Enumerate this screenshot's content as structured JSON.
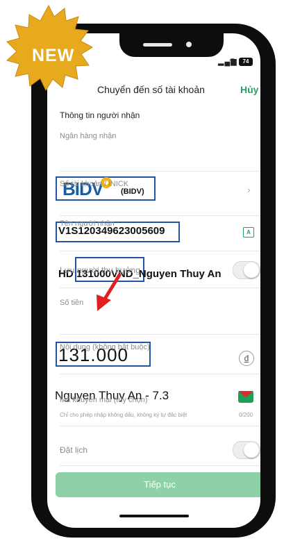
{
  "badge": {
    "text": "NEW"
  },
  "status": {
    "battery": "74"
  },
  "header": {
    "title": "Chuyển đến số tài khoản",
    "cancel": "Hủy"
  },
  "recipient": {
    "section_title": "Thông tin người nhận",
    "bank_label": "Ngân hàng nhận",
    "bank_logo": "BIDV",
    "bank_code": "(BIDV)",
    "account_label": "Số tài khoản / iNICK",
    "account_value": "V1S120349623005609",
    "name_label": "Tên người nhận",
    "name_value": "HD 131000VND_Nguyen Thuy An"
  },
  "save_beneficiary": {
    "label": "Lưu người thụ hưởng",
    "on": false
  },
  "amount": {
    "label": "Số tiền",
    "value": "131.000",
    "currency_symbol": "đ"
  },
  "content": {
    "label": "Nội dung (không bắt buộc)",
    "value": "Nguyen Thuy An - 7.3",
    "hint": "Chỉ cho phép nhập không dấu, không ký tự đặc biệt",
    "counter": "0/200"
  },
  "promo": {
    "label": "Mã khuyến mại (tùy chọn)",
    "icon_glyph": "%"
  },
  "schedule": {
    "label": "Đặt lịch",
    "on": false
  },
  "continue_button": {
    "label": "Tiếp tục"
  },
  "colors": {
    "brand_green": "#27a35a",
    "button_disabled": "#8fd1a7",
    "highlight_box": "#1f55a3",
    "arrow_red": "#e02020",
    "badge_gold": "#e7a91e"
  }
}
